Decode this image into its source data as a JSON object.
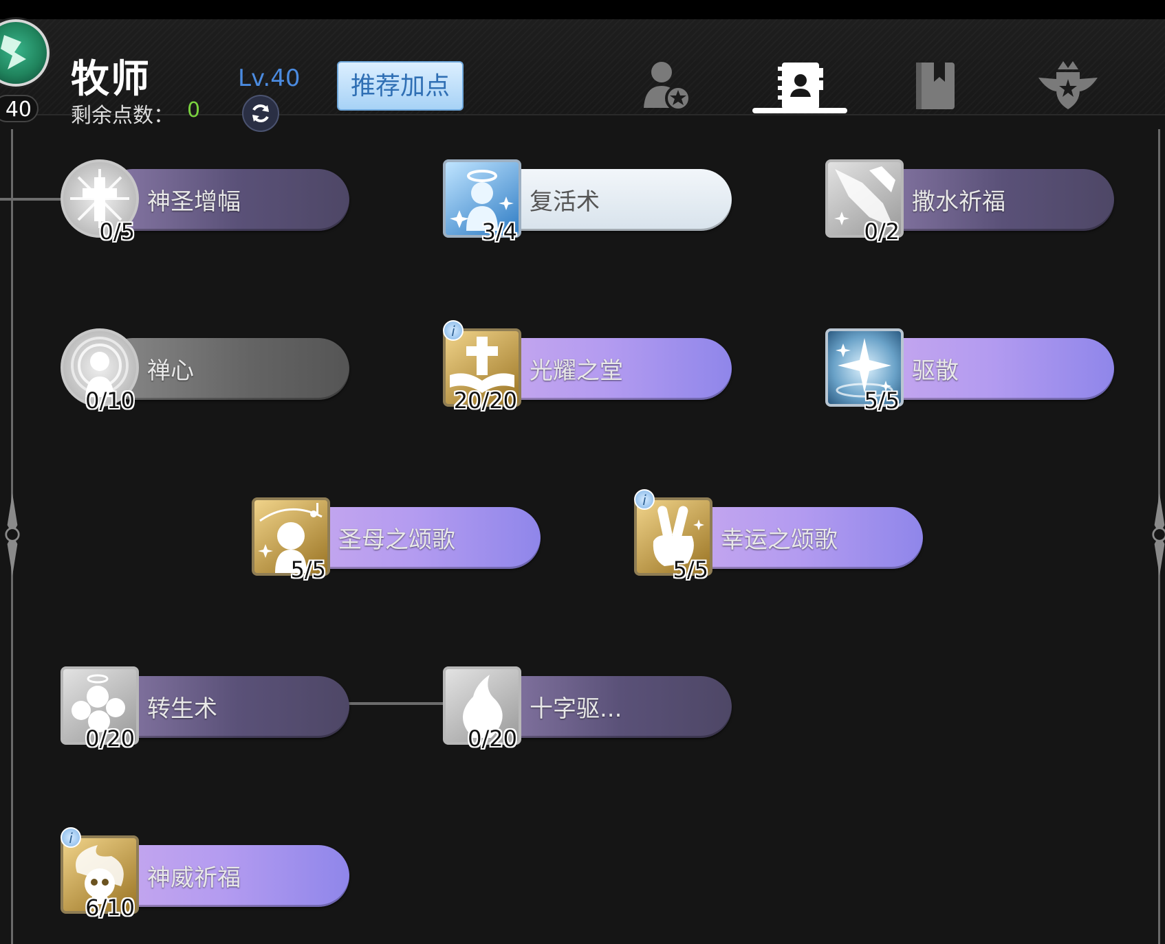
{
  "header": {
    "avatar_level": "40",
    "class_name": "牧师",
    "points_label": "剩余点数：",
    "points_value": "0",
    "level_text": "Lv.40",
    "recommend_button": "推荐加点",
    "tabs": [
      {
        "icon": "person-star-icon",
        "active": false
      },
      {
        "icon": "skill-book-icon",
        "active": true
      },
      {
        "icon": "bookmark-book-icon",
        "active": false
      },
      {
        "icon": "winged-crest-icon",
        "active": false
      }
    ]
  },
  "skills": [
    {
      "name": "神圣增幅",
      "level": "0/5",
      "icon": "holy-cross-icon",
      "state": "locked"
    },
    {
      "name": "复活术",
      "level": "3/4",
      "icon": "angel-halo-icon",
      "state": "learned"
    },
    {
      "name": "撒水祈福",
      "level": "0/2",
      "icon": "holy-water-icon",
      "state": "locked"
    },
    {
      "name": "禅心",
      "level": "0/10",
      "icon": "meditation-icon",
      "state": "grey"
    },
    {
      "name": "光耀之堂",
      "level": "20/20",
      "icon": "holy-book-cross-icon",
      "state": "maxed",
      "info": "i"
    },
    {
      "name": "驱散",
      "level": "5/5",
      "icon": "sparkle-dispel-icon",
      "state": "maxed"
    },
    {
      "name": "圣母之颂歌",
      "level": "5/5",
      "icon": "singing-maiden-icon",
      "state": "maxed"
    },
    {
      "name": "幸运之颂歌",
      "level": "5/5",
      "icon": "victory-hand-icon",
      "state": "maxed",
      "info": "i"
    },
    {
      "name": "转生术",
      "level": "0/20",
      "icon": "souls-icon",
      "state": "locked"
    },
    {
      "name": "十字驱...",
      "level": "0/20",
      "icon": "holy-flame-icon",
      "state": "locked"
    },
    {
      "name": "神威祈福",
      "level": "6/10",
      "icon": "flaming-skull-icon",
      "state": "partial",
      "info": "i"
    }
  ],
  "colors": {
    "background": "#151515",
    "points_value": "#7ad23f",
    "level_text": "#4b8be0",
    "recommend_text": "#2f6fb4"
  }
}
